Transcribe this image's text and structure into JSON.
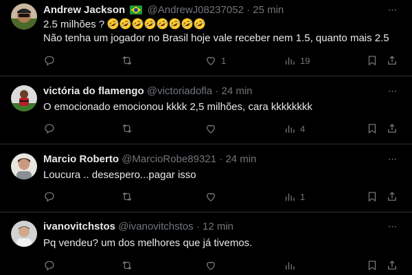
{
  "colors": {
    "background": "#000000",
    "text": "#e7e9ea",
    "muted": "#71767b",
    "divider": "#2f3336"
  },
  "tweets": [
    {
      "display_name": "Andrew Jackson",
      "flag": "brazil-flag",
      "handle": "@AndrewJ08237052",
      "dot": "·",
      "time": "25 min",
      "lines": [
        "2.5 milhões ? ",
        "Não tenha um jogador no Brasil hoje vale receber nem 1.5, quanto mais 2.5"
      ],
      "emoji_name": "rolling-on-floor-laughing-emoji",
      "emoji_count": 8,
      "likes": "1",
      "views": "19"
    },
    {
      "display_name": "victória do flamengo",
      "handle": "@victoriadofla",
      "dot": "·",
      "time": "24 min",
      "lines": [
        "O emocionado emocionou kkkk 2,5 milhões, cara kkkkkkkk"
      ],
      "likes": "",
      "views": "4"
    },
    {
      "display_name": "Marcio Roberto",
      "handle": "@MarcioRobe89321",
      "dot": "·",
      "time": "24 min",
      "lines": [
        "Loucura .. desespero...pagar isso"
      ],
      "likes": "",
      "views": "1"
    },
    {
      "display_name": "ivanovitchstos",
      "handle": "@ivanovitchstos",
      "dot": "·",
      "time": "12 min",
      "lines": [
        "Pq vendeu?  um dos melhores que já tivemos."
      ],
      "likes": "",
      "views": ""
    }
  ],
  "icons": {
    "more": "more-options-icon",
    "reply": "reply-icon",
    "retweet": "retweet-icon",
    "like": "like-icon",
    "views": "views-icon",
    "bookmark": "bookmark-icon",
    "share": "share-icon"
  }
}
